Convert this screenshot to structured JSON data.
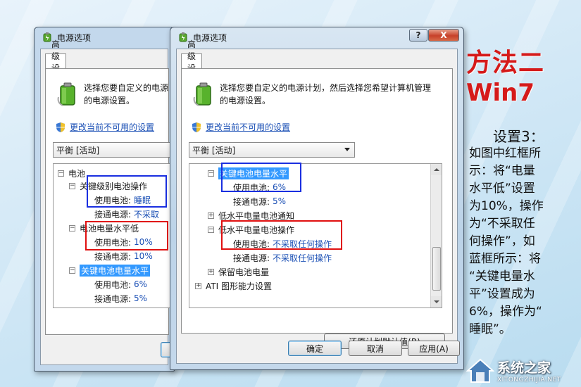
{
  "back_window": {
    "title": "电源选项",
    "tab": "高级设置",
    "description_line1": "选择您要自定义的电源",
    "description_line2": "的电源设置。",
    "change_link": "更改当前不可用的设置",
    "plan_selected": "平衡 [活动]",
    "tree": {
      "battery": "电池",
      "critical_action": "关键级别电池操作",
      "on_battery_label": "使用电池:",
      "critical_action_on_battery": "睡眠",
      "plugged_in_label": "接通电源:",
      "critical_action_plugged": "不采取",
      "low_level": "电池电量水平低",
      "low_level_on_battery": "10%",
      "low_level_plugged": "10%",
      "critical_level": "关键电池电量水平",
      "critical_level_on_battery": "6%",
      "critical_level_plugged": "5%"
    }
  },
  "front_window": {
    "title": "电源选项",
    "help_button": "?",
    "close_button": "X",
    "tab": "高级设置",
    "description_line1": "选择您要自定义的电源计划，然后选择您希望计算机管理",
    "description_line2": "的电源设置。",
    "change_link": "更改当前不可用的设置",
    "plan_selected": "平衡 [活动]",
    "tree": {
      "critical_level": "关键电池电量水平",
      "on_battery_label": "使用电池:",
      "critical_level_on_battery": "6%",
      "plugged_in_label": "接通电源:",
      "critical_level_plugged": "5%",
      "low_notify": "低水平电量电池通知",
      "low_action": "低水平电量电池操作",
      "low_action_on_battery": "不采取任何操作",
      "low_action_plugged": "不采取任何操作",
      "reserve": "保留电池电量",
      "ati": "ATI 图形能力设置"
    },
    "restore_button": "还原计划默认值(R)",
    "ok_button": "确定",
    "cancel_button": "取消",
    "apply_button": "应用(A)"
  },
  "annotation": {
    "method": "方法二",
    "os": "Win7",
    "step_title": "设置3：",
    "step_lines": [
      "如图中红框所",
      "示：将“电量",
      "水平低”设置",
      "为10%，操作",
      "为“不采取任",
      "何操作”，如",
      "蓝框所示：将",
      "“关键电量水",
      "平”设置成为",
      "6%，操作为“",
      "睡眠”。"
    ]
  },
  "watermark": {
    "name": "系统之家",
    "url": "XITONGZHIJIA.NET"
  },
  "colors": {
    "highlight_red": "#e01010",
    "highlight_blue": "#1a2fe0",
    "link_blue": "#1a4fb5",
    "selection": "#3399ff",
    "title_red": "#d51a1a"
  }
}
